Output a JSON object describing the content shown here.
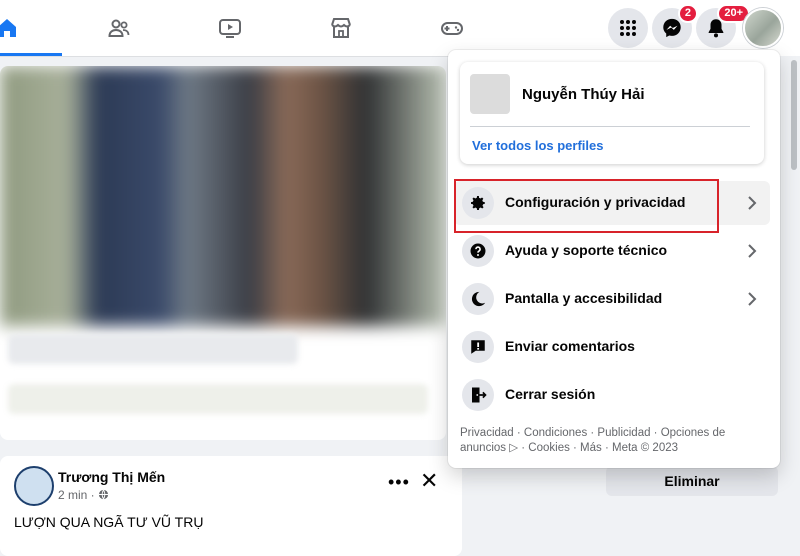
{
  "nav": {
    "tabs": [
      {
        "name": "home",
        "active": true
      },
      {
        "name": "friends",
        "active": false
      },
      {
        "name": "watch",
        "active": false
      },
      {
        "name": "marketplace",
        "active": false
      },
      {
        "name": "gaming",
        "active": false
      }
    ],
    "messenger_badge": "2",
    "notifications_badge": "20+"
  },
  "account_menu": {
    "profile_name": "Nguyễn Thúy Hải",
    "see_all_profiles": "Ver todos los perfiles",
    "items": [
      {
        "label": "Configuración y privacidad",
        "icon": "gear-icon",
        "chevron": true,
        "highlighted": true
      },
      {
        "label": "Ayuda y soporte técnico",
        "icon": "question-icon",
        "chevron": true
      },
      {
        "label": "Pantalla y accesibilidad",
        "icon": "moon-icon",
        "chevron": true
      },
      {
        "label": "Enviar comentarios",
        "icon": "feedback-icon",
        "chevron": false
      },
      {
        "label": "Cerrar sesión",
        "icon": "logout-icon",
        "chevron": false
      }
    ],
    "footer_line1": "Privacidad · Condiciones · Publicidad · Opciones de",
    "footer_line2": "anuncios ▷ · Cookies · Más · Meta © 2023"
  },
  "post": {
    "author": "Trương Thị Mến",
    "time": "2 min · ",
    "text": "LƯỢN QUA NGÃ TƯ VŨ TRỤ",
    "more": "•••",
    "close": "✕"
  },
  "right_panel": {
    "delete_label": "Eliminar"
  },
  "colors": {
    "accent": "#1877f2",
    "badge": "#e41e3f",
    "highlight_box": "#d8232a",
    "link": "#216fdb"
  }
}
